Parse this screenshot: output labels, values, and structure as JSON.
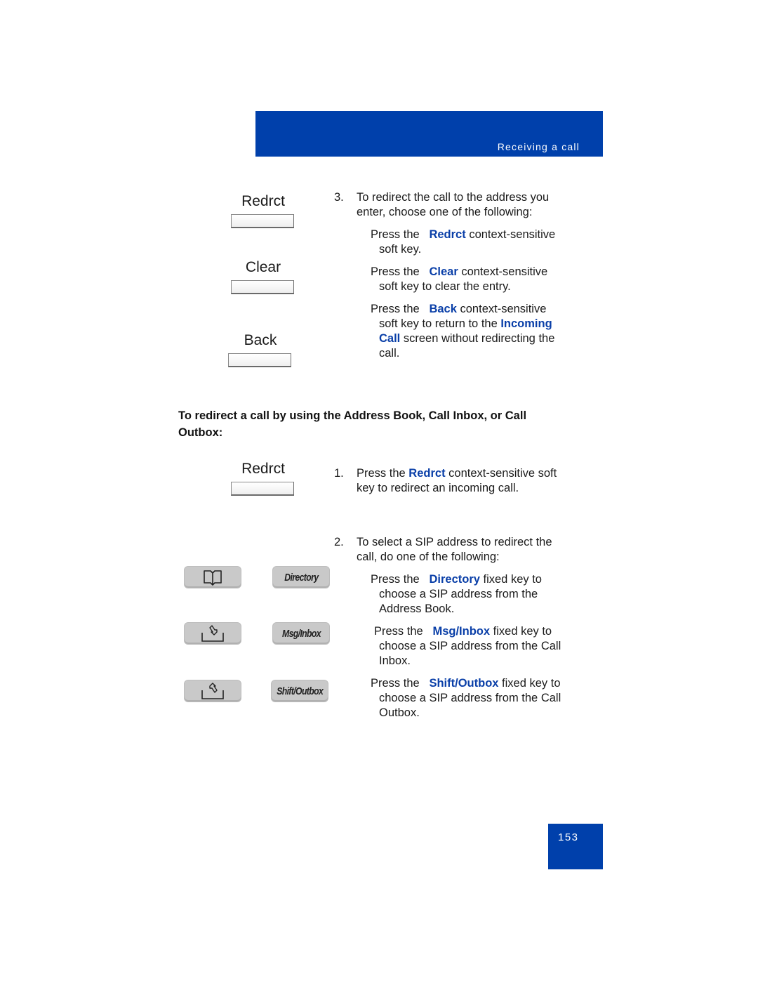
{
  "header": {
    "section_title": "Receiving a call"
  },
  "page_number": "153",
  "softkeys_top": [
    {
      "label": "Redrct"
    },
    {
      "label": "Clear"
    },
    {
      "label": "Back"
    }
  ],
  "step3": {
    "number": "3.",
    "intro_line1": "To redirect the call to the address you",
    "intro_line2": "enter, choose one of the following:",
    "options": [
      {
        "prefix": "Press the ",
        "key": "Redrct",
        "suffix_line1": " context-sensitive",
        "line2": "soft key."
      },
      {
        "prefix": "Press the ",
        "key": "Clear",
        "suffix_line1": " context-sensitive",
        "line2": "soft key to clear the entry."
      },
      {
        "prefix": "Press the ",
        "key": "Back",
        "suffix_line1": " context-sensitive",
        "line2_pre": "soft key to return to the ",
        "line2_key": "Incoming",
        "line3_key": "Call",
        "line3_post": " screen without redirecting the",
        "line4": "call."
      }
    ]
  },
  "procedure_heading": "To redirect a call by using the Address Book, Call Inbox, or Call Outbox:",
  "softkey_redirect": {
    "label": "Redrct"
  },
  "step1": {
    "number": "1.",
    "pre": "Press the ",
    "key": "Redrct",
    "post": " context-sensitive soft",
    "line2": "key to redirect an incoming call."
  },
  "step2": {
    "number": "2.",
    "intro_line1": "To select a SIP address to redirect the",
    "intro_line2": "call, do one of the following:",
    "options": [
      {
        "prefix": "Press the ",
        "key": "Directory",
        "suffix": " fixed key to",
        "line2": "choose a SIP address from the",
        "line3": "Address Book."
      },
      {
        "prefix": "Press the ",
        "key": "Msg/Inbox",
        "suffix": " fixed key to",
        "line2": "choose a SIP address from the Call",
        "line3": "Inbox."
      },
      {
        "prefix": "Press the ",
        "key": "Shift/Outbox",
        "suffix": " fixed key to",
        "line2": "choose a SIP address from the Call",
        "line3": "Outbox."
      }
    ]
  },
  "fixed_keys": [
    {
      "icon": "address-book-icon",
      "label": "Directory"
    },
    {
      "icon": "inbox-icon",
      "label": "Msg/Inbox"
    },
    {
      "icon": "outbox-icon",
      "label": "Shift/Outbox"
    }
  ],
  "colors": {
    "brand_blue": "#0040ab",
    "key_text_blue": "#0a3fa8"
  }
}
